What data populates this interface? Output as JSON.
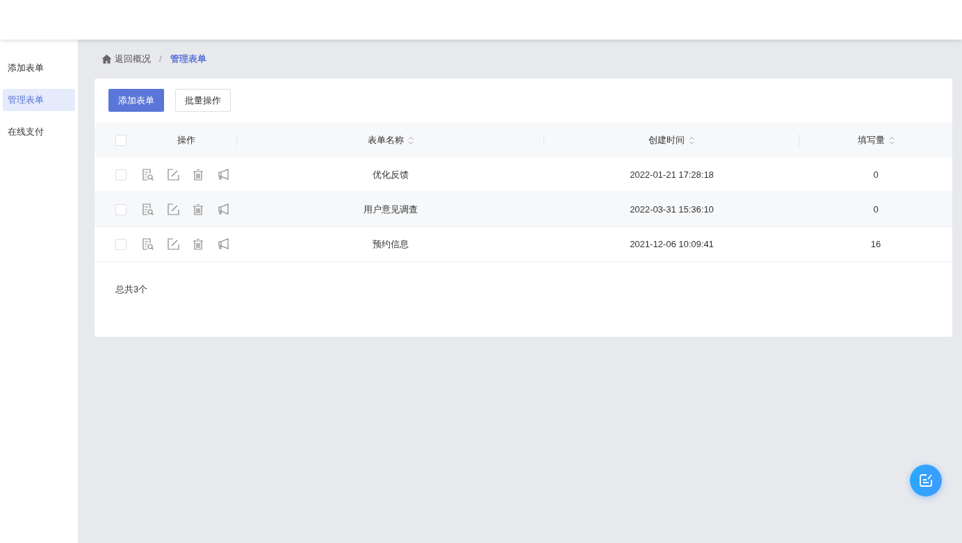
{
  "sidebar": {
    "items": [
      {
        "label": "添加表单",
        "selected": false
      },
      {
        "label": "管理表单",
        "selected": true
      },
      {
        "label": "在线支付",
        "selected": false
      }
    ]
  },
  "breadcrumb": {
    "separator": "/",
    "items": [
      {
        "label": "返回概况",
        "current": false
      },
      {
        "label": "管理表单",
        "current": true
      }
    ]
  },
  "toolbar": {
    "buttons": [
      {
        "label": "添加表单",
        "kind": "primary"
      },
      {
        "label": "批量操作",
        "kind": "default"
      }
    ]
  },
  "table": {
    "select_all": {
      "checked": false
    },
    "columns": [
      {
        "label": "操作",
        "sortable": false
      },
      {
        "label": "表单名称",
        "sortable": true
      },
      {
        "label": "创建时间",
        "sortable": true
      },
      {
        "label": "填写量",
        "sortable": true
      }
    ],
    "rows": [
      {
        "checked": false,
        "name": "优化反馈",
        "created": "2022-01-21 17:28:18",
        "count": "0"
      },
      {
        "checked": false,
        "name": "用户意见调查",
        "created": "2022-03-31 15:36:10",
        "count": "0"
      },
      {
        "checked": false,
        "name": "预约信息",
        "created": "2021-12-06 10:09:41",
        "count": "16"
      }
    ]
  },
  "total": "总共3个"
}
